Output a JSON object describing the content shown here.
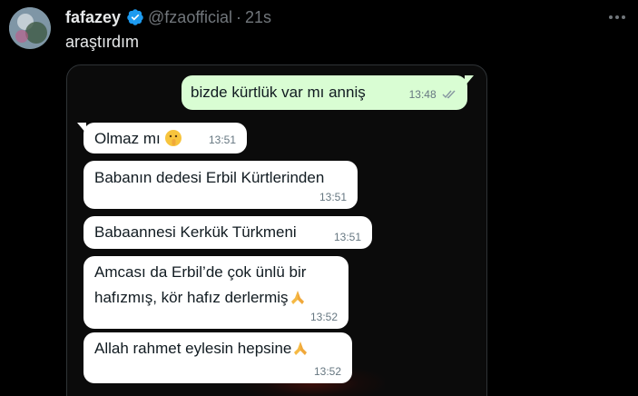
{
  "tweet": {
    "display_name": "fafazey",
    "handle": "@fzaofficial",
    "separator": "·",
    "time": "21s",
    "text": "araştırdım"
  },
  "chat": {
    "messages": [
      {
        "direction": "out",
        "text": "bizde kürtlük var mı anniş",
        "time": "13:48",
        "status_icon": "double-check-icon"
      },
      {
        "direction": "in",
        "text": "Olmaz mı",
        "emoji": "shushing-face-icon",
        "time": "13:51"
      },
      {
        "direction": "in",
        "text": "Babanın dedesi Erbil Kürtlerinden",
        "time": "13:51"
      },
      {
        "direction": "in",
        "text": "Babaannesi Kerkük Türkmeni",
        "time": "13:51"
      },
      {
        "direction": "in",
        "text_line1": "Amcası da Erbil’de çok ünlü bir",
        "text_line2": "hafızmış, kör hafız derlermiş",
        "emoji": "folded-hands-icon",
        "time": "13:52"
      },
      {
        "direction": "in",
        "text": "Allah rahmet eylesin hepsine",
        "emoji": "folded-hands-icon",
        "time": "13:52"
      }
    ]
  },
  "colors": {
    "background": "#000000",
    "primary_text": "#e7e9ea",
    "secondary_text": "#71767b",
    "verified": "#1d9bf0",
    "outgoing_bubble": "#d9fdd3",
    "incoming_bubble": "#ffffff"
  }
}
